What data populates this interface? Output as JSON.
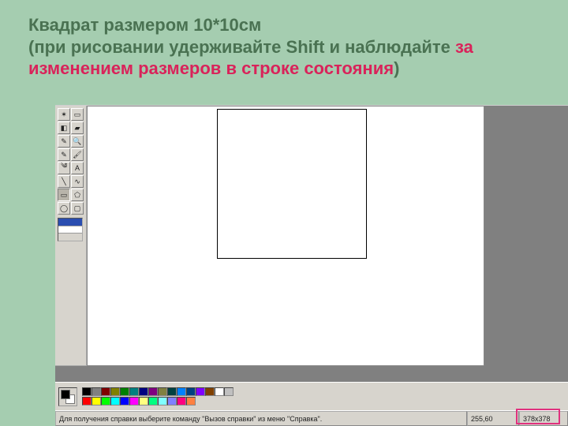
{
  "header": {
    "line1": "Квадрат размером 10*10см",
    "line2a": "(при рисовании удерживайте Shift и наблюдайте ",
    "line2b": "за изменением размеров в строке состояния",
    "line2c": ")"
  },
  "tools": [
    {
      "name": "free-select",
      "glyph": "✶"
    },
    {
      "name": "rect-select",
      "glyph": "▭"
    },
    {
      "name": "eraser",
      "glyph": "◧"
    },
    {
      "name": "fill",
      "glyph": "▰"
    },
    {
      "name": "picker",
      "glyph": "✎"
    },
    {
      "name": "magnifier",
      "glyph": "🔍"
    },
    {
      "name": "pencil",
      "glyph": "✎"
    },
    {
      "name": "brush",
      "glyph": "🖌"
    },
    {
      "name": "airbrush",
      "glyph": "༄"
    },
    {
      "name": "text",
      "glyph": "A"
    },
    {
      "name": "line",
      "glyph": "╲"
    },
    {
      "name": "curve",
      "glyph": "∿"
    },
    {
      "name": "rectangle",
      "glyph": "▭",
      "selected": true
    },
    {
      "name": "polygon",
      "glyph": "⬠"
    },
    {
      "name": "ellipse",
      "glyph": "◯"
    },
    {
      "name": "rounded-rect",
      "glyph": "▢"
    }
  ],
  "palette": [
    "#000000",
    "#808080",
    "#800000",
    "#808000",
    "#008000",
    "#008080",
    "#000080",
    "#800080",
    "#808040",
    "#004040",
    "#0080ff",
    "#004080",
    "#8000ff",
    "#804000",
    "#ffffff",
    "#c0c0c0",
    "#ff0000",
    "#ffff00",
    "#00ff00",
    "#00ffff",
    "#0000ff",
    "#ff00ff",
    "#ffff80",
    "#00ff80",
    "#80ffff",
    "#8080ff",
    "#ff0080",
    "#ff8040"
  ],
  "status": {
    "hint": "Для получения справки выберите команду \"Вызов справки\" из меню \"Справка\".",
    "coords": "255,60",
    "size": "378x378"
  }
}
